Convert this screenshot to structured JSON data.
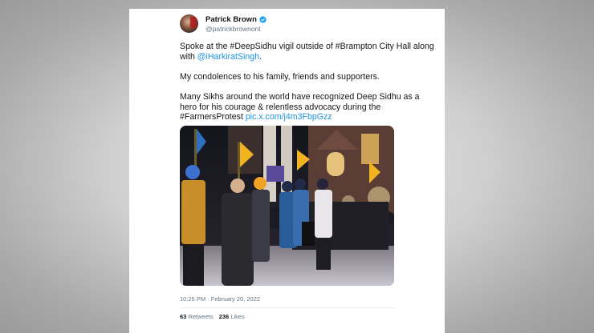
{
  "tweet": {
    "author": {
      "display_name": "Patrick Brown",
      "handle": "@patrickbrownont",
      "verified": true
    },
    "paragraphs": [
      {
        "segments": [
          {
            "text": "Spoke at the #DeepSidhu vigil outside of #Brampton City Hall along with ",
            "link": false
          },
          {
            "text": "@iHarkiratSingh",
            "link": true
          },
          {
            "text": ".",
            "link": false
          }
        ]
      },
      {
        "segments": [
          {
            "text": "My condolences to his family, friends and supporters.",
            "link": false
          }
        ]
      },
      {
        "segments": [
          {
            "text": "Many Sikhs around the world have recognized Deep Sidhu as a hero for his courage & relentless advocacy during the #FarmersProtest ",
            "link": false
          },
          {
            "text": "pic.x.com/j4m3FbpGzz",
            "link": true
          }
        ]
      }
    ],
    "timestamp": "10:25 PM · February 20, 2022",
    "stats": {
      "retweets_count": "63",
      "retweets_label": "Retweets",
      "likes_count": "236",
      "likes_label": "Likes"
    }
  },
  "colors": {
    "link": "#1b95e0",
    "verified": "#1da1f2",
    "muted": "#657786",
    "text": "#14171a"
  },
  "icons": [
    "verified-badge-icon"
  ]
}
